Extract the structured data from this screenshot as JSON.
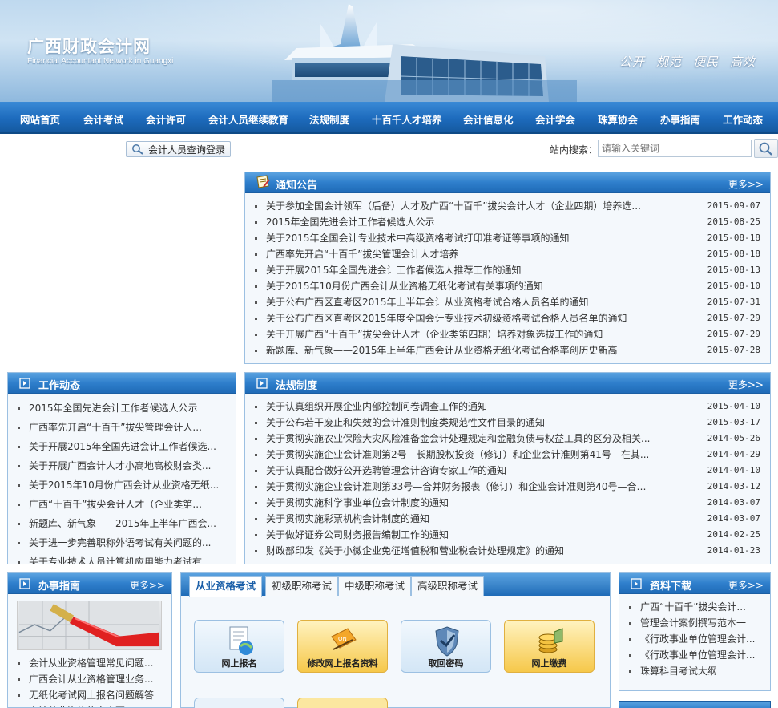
{
  "header": {
    "site_title": "广西财政会计网",
    "site_title_en": "Financial Accountant Network in Guangxi",
    "slogans": [
      "公开",
      "规范",
      "便民",
      "高效"
    ]
  },
  "nav": {
    "items": [
      "网站首页",
      "会计考试",
      "会计许可",
      "会计人员继续教育",
      "法规制度",
      "十百千人才培养",
      "会计信息化",
      "会计学会",
      "珠算协会",
      "办事指南",
      "工作动态"
    ]
  },
  "toolbar": {
    "accountant_query_label": "会计人员查询登录",
    "search_label": "站内搜索：",
    "search_placeholder": "请输入关键词"
  },
  "notices": {
    "title": "通知公告",
    "more": "更多>>",
    "items": [
      {
        "title": "关于参加全国会计领军（后备）人才及广西“十百千”拔尖会计人才（企业四期）培养选...",
        "date": "2015-09-07"
      },
      {
        "title": "2015年全国先进会计工作者候选人公示",
        "date": "2015-08-25"
      },
      {
        "title": "关于2015年全国会计专业技术中高级资格考试打印准考证等事项的通知",
        "date": "2015-08-18"
      },
      {
        "title": "广西率先开启“十百千”拔尖管理会计人才培养",
        "date": "2015-08-18"
      },
      {
        "title": "关于开展2015年全国先进会计工作者候选人推荐工作的通知",
        "date": "2015-08-13"
      },
      {
        "title": "关于2015年10月份广西会计从业资格无纸化考试有关事项的通知",
        "date": "2015-08-10"
      },
      {
        "title": "关于公布广西区直考区2015年上半年会计从业资格考试合格人员名单的通知",
        "date": "2015-07-31"
      },
      {
        "title": "关于公布广西区直考区2015年度全国会计专业技术初级资格考试合格人员名单的通知",
        "date": "2015-07-29"
      },
      {
        "title": "关于开展广西“十百千”拔尖会计人才（企业类第四期）培养对象选拔工作的通知",
        "date": "2015-07-29"
      },
      {
        "title": "新题库、新气象——2015年上半年广西会计从业资格无纸化考试合格率创历史新高",
        "date": "2015-07-28"
      }
    ]
  },
  "work": {
    "title": "工作动态",
    "items": [
      "2015年全国先进会计工作者候选人公示",
      "广西率先开启“十百千”拔尖管理会计人...",
      "关于开展2015年全国先进会计工作者候选...",
      "关于开展广西会计人才小高地高校财会类...",
      "关于2015年10月份广西会计从业资格无纸...",
      "广西“十百千”拔尖会计人才（企业类第...",
      "新题库、新气象——2015年上半年广西会...",
      "关于进一步完善职称外语考试有关问题的...",
      "关于专业技术人员计算机应用能力考试有..."
    ]
  },
  "laws": {
    "title": "法规制度",
    "more": "更多>>",
    "items": [
      {
        "title": "关于认真组织开展企业内部控制问卷调查工作的通知",
        "date": "2015-04-10"
      },
      {
        "title": "关于公布若干废止和失效的会计准则制度类规范性文件目录的通知",
        "date": "2015-03-17"
      },
      {
        "title": "关于贯彻实施农业保险大灾风险准备金会计处理规定和金融负债与权益工具的区分及相关...",
        "date": "2014-05-26"
      },
      {
        "title": "关于贯彻实施企业会计准则第2号—长期股权投资（修订）和企业会计准则第41号—在其...",
        "date": "2014-04-29"
      },
      {
        "title": "关于认真配合做好公开选聘管理会计咨询专家工作的通知",
        "date": "2014-04-10"
      },
      {
        "title": "关于贯彻实施企业会计准则第33号—合并财务报表（修订）和企业会计准则第40号—合营...",
        "date": "2014-03-12"
      },
      {
        "title": "关于贯彻实施科学事业单位会计制度的通知",
        "date": "2014-03-07"
      },
      {
        "title": "关于贯彻实施彩票机构会计制度的通知",
        "date": "2014-03-07"
      },
      {
        "title": "关于做好证券公司财务报告编制工作的通知",
        "date": "2014-02-25"
      },
      {
        "title": "财政部印发《关于小微企业免征增值税和营业税会计处理规定》的通知",
        "date": "2014-01-23"
      }
    ]
  },
  "guide": {
    "title": "办事指南",
    "more": "更多>>",
    "items": [
      "会计从业资格管理常见问题...",
      "广西会计从业资格管理业务...",
      "无纸化考试网上报名问题解答",
      "会计从业资格信息变更..."
    ]
  },
  "exams": {
    "tabs": [
      "从业资格考试",
      "初级职称考试",
      "中级职称考试",
      "高级职称考试"
    ],
    "active_tab": 0,
    "tiles": [
      "网上报名",
      "修改网上报名资料",
      "取回密码",
      "网上缴费"
    ]
  },
  "downloads": {
    "title": "资料下载",
    "more": "更多>>",
    "items": [
      "广西“十百千”拔尖会计...",
      "管理会计案例撰写范本一",
      "《行政事业单位管理会计...",
      "《行政事业单位管理会计...",
      "珠算科目考试大纲"
    ]
  },
  "colors": {
    "nav_blue": "#1d6bbd",
    "panel_border": "#9cc0e2",
    "tab_active_text": "#1b5fa8"
  }
}
